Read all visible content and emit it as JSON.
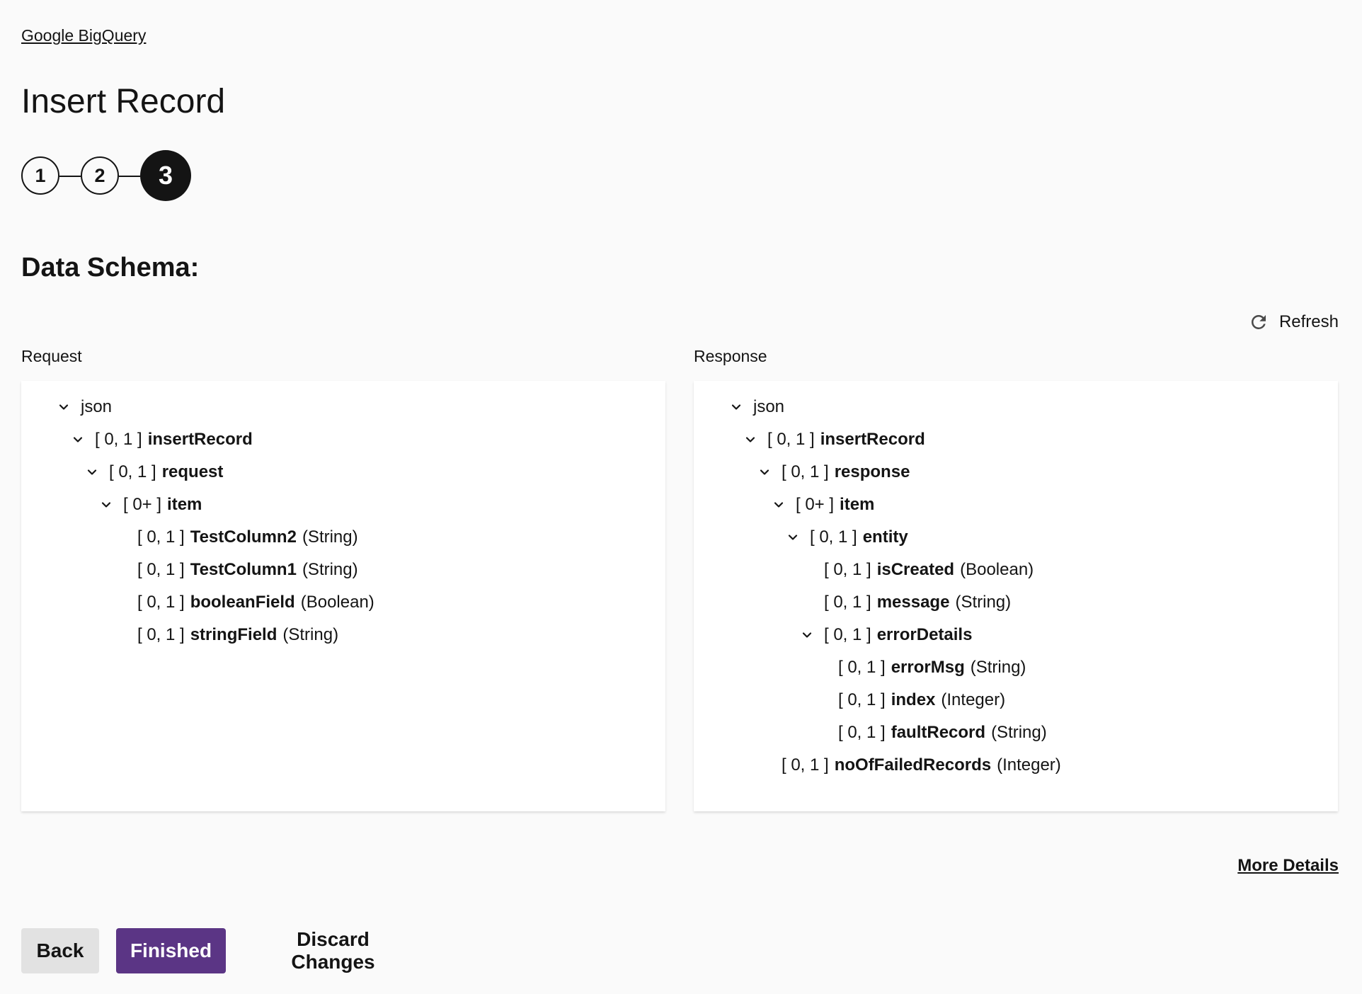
{
  "breadcrumb": "Google BigQuery",
  "page_title": "Insert Record",
  "stepper": {
    "steps": [
      "1",
      "2",
      "3"
    ],
    "active_step": 3
  },
  "section_title": "Data Schema:",
  "refresh": {
    "label": "Refresh",
    "icon": "refresh-icon"
  },
  "request": {
    "label": "Request",
    "tree": [
      {
        "card": "",
        "name": "json",
        "type": "",
        "expandable": true,
        "bold": false
      },
      {
        "card": "[ 0, 1 ]",
        "name": "insertRecord",
        "type": "",
        "expandable": true,
        "bold": true
      },
      {
        "card": "[ 0, 1 ]",
        "name": "request",
        "type": "",
        "expandable": true,
        "bold": true
      },
      {
        "card": "[ 0+ ]",
        "name": "item",
        "type": "",
        "expandable": true,
        "bold": true
      },
      {
        "card": "[ 0, 1 ]",
        "name": "TestColumn2",
        "type": "(String)",
        "expandable": false,
        "bold": true
      },
      {
        "card": "[ 0, 1 ]",
        "name": "TestColumn1",
        "type": "(String)",
        "expandable": false,
        "bold": true
      },
      {
        "card": "[ 0, 1 ]",
        "name": "booleanField",
        "type": "(Boolean)",
        "expandable": false,
        "bold": true
      },
      {
        "card": "[ 0, 1 ]",
        "name": "stringField",
        "type": "(String)",
        "expandable": false,
        "bold": true
      }
    ]
  },
  "response": {
    "label": "Response",
    "tree": [
      {
        "card": "",
        "name": "json",
        "type": "",
        "expandable": true,
        "bold": false
      },
      {
        "card": "[ 0, 1 ]",
        "name": "insertRecord",
        "type": "",
        "expandable": true,
        "bold": true
      },
      {
        "card": "[ 0, 1 ]",
        "name": "response",
        "type": "",
        "expandable": true,
        "bold": true
      },
      {
        "card": "[ 0+ ]",
        "name": "item",
        "type": "",
        "expandable": true,
        "bold": true
      },
      {
        "card": "[ 0, 1 ]",
        "name": "entity",
        "type": "",
        "expandable": true,
        "bold": true
      },
      {
        "card": "[ 0, 1 ]",
        "name": "isCreated",
        "type": "(Boolean)",
        "expandable": false,
        "bold": true
      },
      {
        "card": "[ 0, 1 ]",
        "name": "message",
        "type": "(String)",
        "expandable": false,
        "bold": true
      },
      {
        "card": "[ 0, 1 ]",
        "name": "errorDetails",
        "type": "",
        "expandable": true,
        "bold": true
      },
      {
        "card": "[ 0, 1 ]",
        "name": "errorMsg",
        "type": "(String)",
        "expandable": false,
        "bold": true
      },
      {
        "card": "[ 0, 1 ]",
        "name": "index",
        "type": "(Integer)",
        "expandable": false,
        "bold": true
      },
      {
        "card": "[ 0, 1 ]",
        "name": "faultRecord",
        "type": "(String)",
        "expandable": false,
        "bold": true
      },
      {
        "card": "[ 0, 1 ]",
        "name": "noOfFailedRecords",
        "type": "(Integer)",
        "expandable": false,
        "bold": true
      }
    ]
  },
  "more_details": "More Details",
  "buttons": {
    "back": "Back",
    "finished": "Finished",
    "discard": "Discard Changes"
  },
  "colors": {
    "accent": "#5b3585",
    "text": "#141414",
    "background": "#fafafa",
    "panel": "#ffffff",
    "secondary_button": "#e2e2e2"
  }
}
